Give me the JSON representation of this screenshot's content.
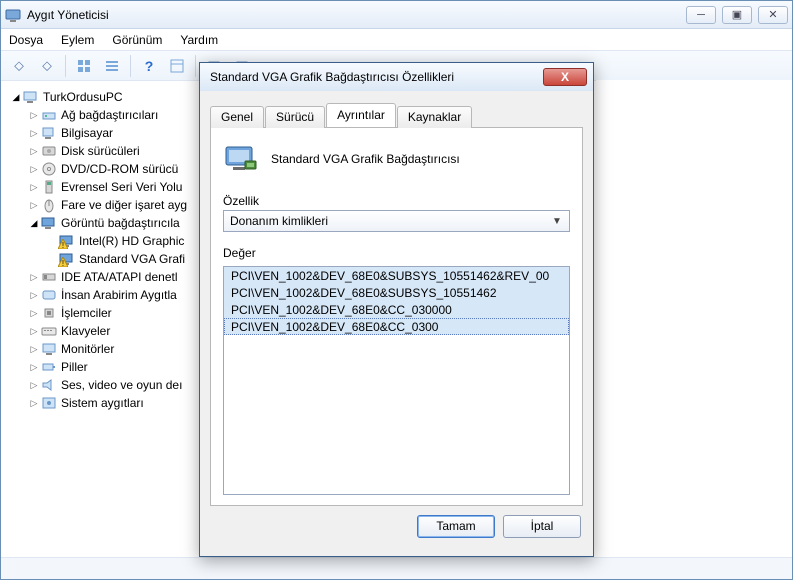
{
  "window": {
    "title": "Aygıt Yöneticisi",
    "menus": [
      "Dosya",
      "Eylem",
      "Görünüm",
      "Yardım"
    ],
    "win_buttons": {
      "min": "─",
      "max": "▣",
      "close": "✕"
    }
  },
  "tree": {
    "root": "TurkOrdusuPC",
    "items": [
      {
        "label": "Ağ bağdaştırıcıları",
        "icon": "net"
      },
      {
        "label": "Bilgisayar",
        "icon": "pc"
      },
      {
        "label": "Disk sürücüleri",
        "icon": "disk"
      },
      {
        "label": "DVD/CD-ROM sürücü",
        "icon": "cd"
      },
      {
        "label": "Evrensel Seri Veri Yolu",
        "icon": "usb"
      },
      {
        "label": "Fare ve diğer işaret ayg",
        "icon": "mouse"
      },
      {
        "label": "Görüntü bağdaştırıcıla",
        "icon": "display",
        "open": true,
        "children": [
          {
            "label": "Intel(R) HD Graphic",
            "warn": true
          },
          {
            "label": "Standard VGA Grafi",
            "warn": true
          }
        ]
      },
      {
        "label": "IDE ATA/ATAPI denetl",
        "icon": "ide"
      },
      {
        "label": "İnsan Arabirim Aygıtla",
        "icon": "hid"
      },
      {
        "label": "İşlemciler",
        "icon": "cpu"
      },
      {
        "label": "Klavyeler",
        "icon": "kb"
      },
      {
        "label": "Monitörler",
        "icon": "mon"
      },
      {
        "label": "Piller",
        "icon": "bat"
      },
      {
        "label": "Ses, video ve oyun deı",
        "icon": "snd"
      },
      {
        "label": "Sistem aygıtları",
        "icon": "sys"
      }
    ]
  },
  "dialog": {
    "title": "Standard VGA Grafik Bağdaştırıcısı Özellikleri",
    "tabs": [
      "Genel",
      "Sürücü",
      "Ayrıntılar",
      "Kaynaklar"
    ],
    "active_tab": 2,
    "device_name": "Standard VGA Grafik Bağdaştırıcısı",
    "property_label": "Özellik",
    "property_value": "Donanım kimlikleri",
    "value_label": "Değer",
    "values": [
      "PCI\\VEN_1002&DEV_68E0&SUBSYS_10551462&REV_00",
      "PCI\\VEN_1002&DEV_68E0&SUBSYS_10551462",
      "PCI\\VEN_1002&DEV_68E0&CC_030000",
      "PCI\\VEN_1002&DEV_68E0&CC_0300"
    ],
    "ok": "Tamam",
    "cancel": "İptal"
  }
}
